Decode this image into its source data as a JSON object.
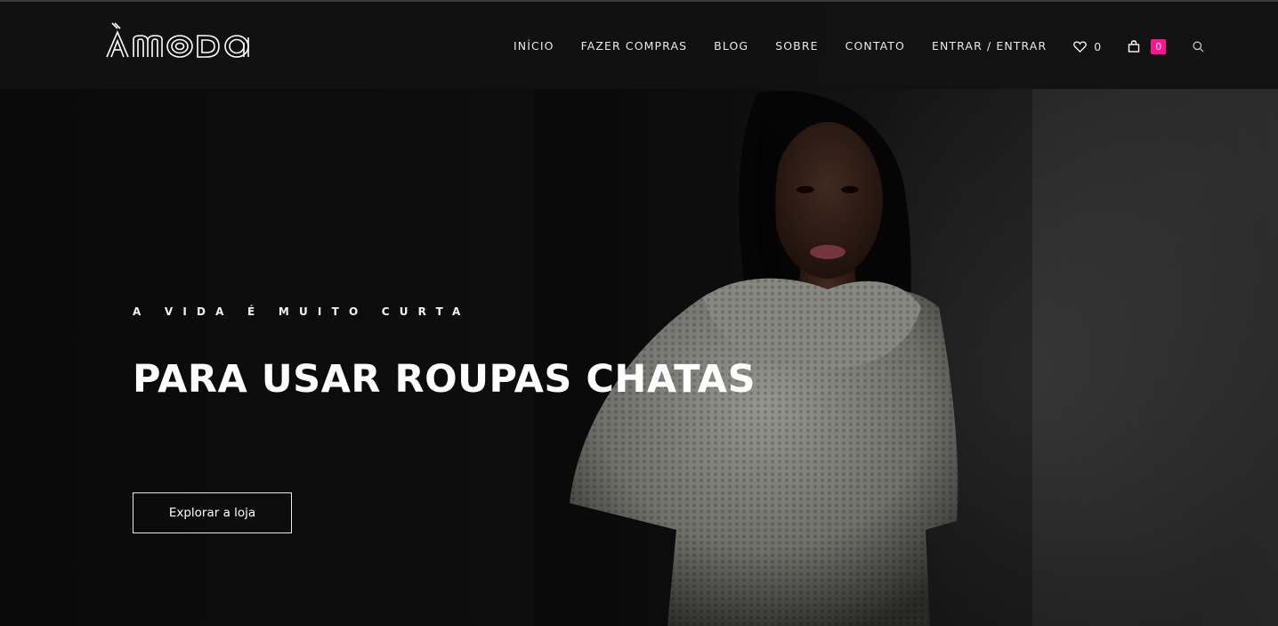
{
  "brand": {
    "logo_text": "ÀMODA"
  },
  "nav": {
    "items": [
      {
        "label": "INÍCIO"
      },
      {
        "label": "FAZER COMPRAS"
      },
      {
        "label": "BLOG"
      },
      {
        "label": "SOBRE"
      },
      {
        "label": "CONTATO"
      },
      {
        "label": "ENTRAR / ENTRAR"
      }
    ],
    "wishlist_count": "0",
    "cart_count": "0"
  },
  "hero": {
    "eyebrow": "A VIDA É MUITO CURTA",
    "headline": "PARA USAR ROUPAS CHATAS",
    "cta_label": "Explorar a loja"
  },
  "icons": {
    "wishlist": "heart-icon",
    "cart": "shopping-bag-icon",
    "search": "search-icon"
  },
  "colors": {
    "accent": "#ff1493",
    "header_bg": "#121212",
    "text": "#ffffff"
  }
}
